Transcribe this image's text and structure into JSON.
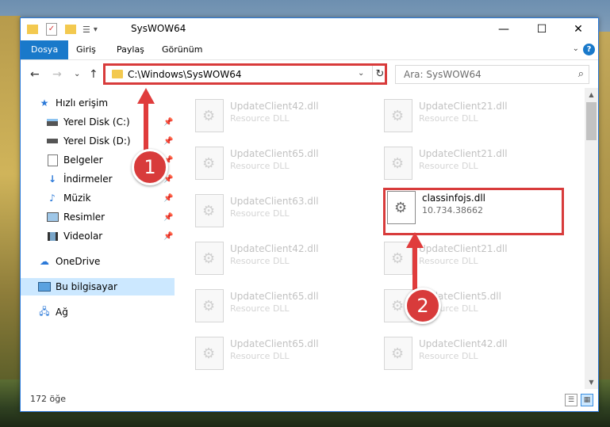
{
  "window": {
    "title": "SysWOW64",
    "minimize_glyph": "—",
    "maximize_glyph": "☐",
    "close_glyph": "✕"
  },
  "ribbon": {
    "tabs": [
      "Dosya",
      "Giriş",
      "Paylaş",
      "Görünüm"
    ],
    "help_glyph": "?",
    "collapse_glyph": "⌄"
  },
  "navigation": {
    "back_glyph": "←",
    "forward_glyph": "→",
    "recent_glyph": "⌄",
    "up_glyph": "↑",
    "address": "C:\\Windows\\SysWOW64",
    "address_dropdown_glyph": "⌄",
    "refresh_glyph": "↻",
    "search_placeholder": "Ara: SysWOW64",
    "search_glyph": "⌕"
  },
  "sidebar": {
    "items": [
      {
        "label": "Hızlı erişim",
        "icon": "star-icon"
      },
      {
        "label": "Yerel Disk (C:)",
        "icon": "drive-icon",
        "pinned": true
      },
      {
        "label": "Yerel Disk (D:)",
        "icon": "drive-icon",
        "pinned": true
      },
      {
        "label": "Belgeler",
        "icon": "documents-icon",
        "pinned": true
      },
      {
        "label": "İndirmeler",
        "icon": "download-icon",
        "pinned": true
      },
      {
        "label": "Müzik",
        "icon": "music-icon",
        "pinned": true
      },
      {
        "label": "Resimler",
        "icon": "pictures-icon",
        "pinned": true
      },
      {
        "label": "Videolar",
        "icon": "videos-icon",
        "pinned": true
      },
      {
        "label": "OneDrive",
        "icon": "cloud-icon"
      },
      {
        "label": "Bu bilgisayar",
        "icon": "computer-icon",
        "selected": true
      },
      {
        "label": "Ağ",
        "icon": "network-icon"
      }
    ],
    "pin_glyph": "📌"
  },
  "files": [
    {
      "name": "UpdateClient42.dll",
      "sub": "Resource DLL"
    },
    {
      "name": "UpdateClient21.dll",
      "sub": "Resource DLL"
    },
    {
      "name": "UpdateClient65.dll",
      "sub": "Resource DLL"
    },
    {
      "name": "UpdateClient21.dll",
      "sub": "Resource DLL"
    },
    {
      "name": "UpdateClient63.dll",
      "sub": "Resource DLL"
    },
    {
      "name": "classinfojs.dll",
      "sub": "10.734.38662",
      "highlighted": true
    },
    {
      "name": "UpdateClient42.dll",
      "sub": "Resource DLL"
    },
    {
      "name": "UpdateClient21.dll",
      "sub": "Resource DLL"
    },
    {
      "name": "UpdateClient65.dll",
      "sub": "Resource DLL"
    },
    {
      "name": "UpdateClient5.dll",
      "sub": "Resource DLL"
    },
    {
      "name": "UpdateClient65.dll",
      "sub": "Resource DLL"
    },
    {
      "name": "UpdateClient42.dll",
      "sub": "Resource DLL"
    }
  ],
  "status": {
    "item_count": "172 öğe"
  },
  "annotations": {
    "step1": "1",
    "step2": "2",
    "accent_color": "#d83b3b"
  },
  "colors": {
    "ribbon_active": "#1979ca",
    "selected_row": "#cce8ff"
  }
}
